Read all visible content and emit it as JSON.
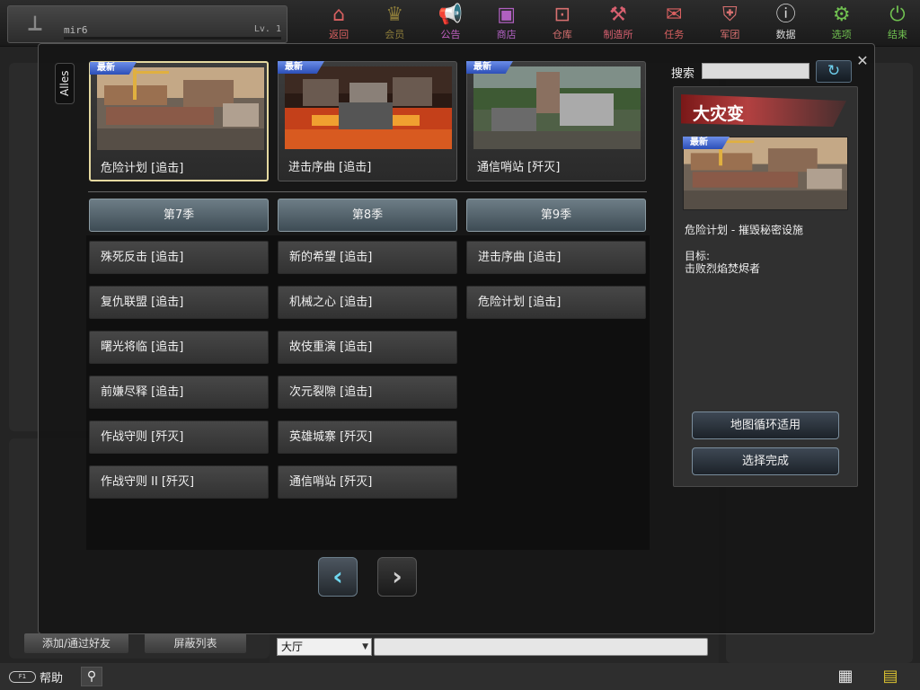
{
  "player": {
    "name": "mir6",
    "level": "Lv. 1"
  },
  "nav": [
    {
      "label": "返回",
      "icon": "home-icon",
      "glyph": "⌂",
      "color": "#d86060"
    },
    {
      "label": "会员",
      "icon": "crown-icon",
      "glyph": "♛",
      "color": "#8a7a3a"
    },
    {
      "label": "公告",
      "icon": "megaphone-icon",
      "glyph": "📢",
      "color": "#c060c0"
    },
    {
      "label": "商店",
      "icon": "shop-icon",
      "glyph": "▣",
      "color": "#b060c0"
    },
    {
      "label": "仓库",
      "icon": "briefcase-icon",
      "glyph": "⊡",
      "color": "#d87070"
    },
    {
      "label": "制造所",
      "icon": "craft-icon",
      "glyph": "⚒",
      "color": "#d86070"
    },
    {
      "label": "任务",
      "icon": "quest-icon",
      "glyph": "✉",
      "color": "#d86060"
    },
    {
      "label": "军团",
      "icon": "shield-icon",
      "glyph": "⛨",
      "color": "#d87070"
    },
    {
      "label": "数据",
      "icon": "info-icon",
      "glyph": "ⓘ",
      "color": "#d8d8d8"
    },
    {
      "label": "选项",
      "icon": "gear-icon",
      "glyph": "⚙",
      "color": "#70c050"
    },
    {
      "label": "结束",
      "icon": "power-icon",
      "glyph": "⏻",
      "color": "#70c050"
    }
  ],
  "filter_tab": "Alles",
  "new_badge": "最新",
  "featured_maps": [
    {
      "name": "危险计划 [追击]",
      "selected": true,
      "scene": "dock"
    },
    {
      "name": "进击序曲 [追击]",
      "selected": false,
      "scene": "lava"
    },
    {
      "name": "通信哨站 [歼灭]",
      "selected": false,
      "scene": "jungle"
    }
  ],
  "seasons": [
    "第7季",
    "第8季",
    "第9季"
  ],
  "map_columns": [
    [
      "殊死反击 [追击]",
      "复仇联盟 [追击]",
      "曙光将临 [追击]",
      "前嫌尽释 [追击]",
      "作战守则 [歼灭]",
      "作战守则 II [歼灭]"
    ],
    [
      "新的希望 [追击]",
      "机械之心 [追击]",
      "故伎重演 [追击]",
      "次元裂隙 [追击]",
      "英雄城寨 [歼灭]",
      "通信哨站 [歼灭]"
    ],
    [
      "进击序曲 [追击]",
      "危险计划 [追击]"
    ]
  ],
  "search": {
    "label": "搜索",
    "value": ""
  },
  "detail": {
    "title": "大灾变",
    "subtitle": "危险计划 - 摧毁秘密设施",
    "goal_label": "目标:",
    "goal_text": "击败烈焰焚烬者",
    "rotation_button": "地图循环适用",
    "done_button": "选择完成"
  },
  "left_panel": {
    "add_friend": "添加/通过好友",
    "block_list": "屏蔽列表"
  },
  "chat": {
    "channel": "大厅",
    "input": ""
  },
  "bottom": {
    "help": "帮助",
    "keycap": "F1"
  },
  "colors": {
    "new_badge": "#3f63cc",
    "accent": "#6fd8f0",
    "season_tab": "#56656e"
  }
}
